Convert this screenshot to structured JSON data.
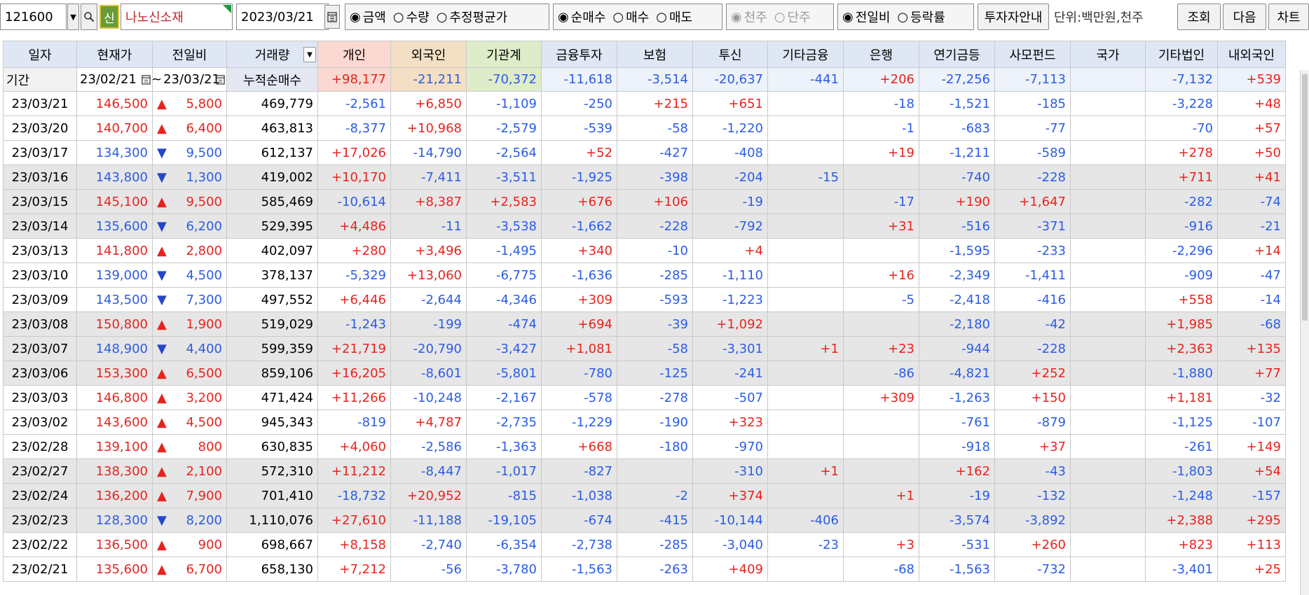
{
  "toolbar": {
    "code": "121600",
    "code_dropdown": "▼",
    "search_icon": "search-icon",
    "new_badge": "신",
    "name": "나노신소재",
    "date": "2023/03/21",
    "amount_options": [
      "금액",
      "수량",
      "추정평균가"
    ],
    "amount_selected": 0,
    "trade_options": [
      "순매수",
      "매수",
      "매도"
    ],
    "trade_selected": 0,
    "unit_options": [
      "천주",
      "단주"
    ],
    "unit_selected": 0,
    "compare_options": [
      "전일비",
      "등락률"
    ],
    "compare_selected": 0,
    "investor_guide": "투자자안내",
    "unit_text": "단위:백만원,천주",
    "query_btn": "조회",
    "next_btn": "다음",
    "chart_btn": "차트"
  },
  "period": {
    "label": "기간",
    "from": "23/02/21",
    "to": "23/03/21",
    "separator": "~",
    "cumulative_label": "누적순매수",
    "sums": [
      "+98,177",
      "-21,211",
      "-70,372",
      "-11,618",
      "-3,514",
      "-20,637",
      "-441",
      "+206",
      "-27,256",
      "-7,113",
      "",
      "-7,132",
      "+539"
    ]
  },
  "columns": [
    "일자",
    "현재가",
    "전일비",
    "거래량",
    "개인",
    "외국인",
    "기관계",
    "금융투자",
    "보험",
    "투신",
    "기타금융",
    "은행",
    "연기금등",
    "사모펀드",
    "국가",
    "기타법인",
    "내외국인"
  ],
  "accent_colors": {
    "up": "#e8231e",
    "down": "#2b5ce6",
    "individual_bg": "#fbd9d2",
    "foreign_bg": "#f3dfc3",
    "institution_bg": "#dfecc9",
    "header_bg": "#dfe7f5"
  },
  "rows": [
    {
      "date": "23/03/21",
      "price": "146,500",
      "dir": "up",
      "chg": "5,800",
      "vol": "469,779",
      "v": [
        "-2,561",
        "+6,850",
        "-1,109",
        "-250",
        "+215",
        "+651",
        "",
        "-18",
        "-1,521",
        "-185",
        "",
        "-3,228",
        "+48"
      ],
      "gray": false
    },
    {
      "date": "23/03/20",
      "price": "140,700",
      "dir": "up",
      "chg": "6,400",
      "vol": "463,813",
      "v": [
        "-8,377",
        "+10,968",
        "-2,579",
        "-539",
        "-58",
        "-1,220",
        "",
        "-1",
        "-683",
        "-77",
        "",
        "-70",
        "+57"
      ],
      "gray": false
    },
    {
      "date": "23/03/17",
      "price": "134,300",
      "dir": "down",
      "chg": "9,500",
      "vol": "612,137",
      "v": [
        "+17,026",
        "-14,790",
        "-2,564",
        "+52",
        "-427",
        "-408",
        "",
        "+19",
        "-1,211",
        "-589",
        "",
        "+278",
        "+50"
      ],
      "gray": false
    },
    {
      "date": "23/03/16",
      "price": "143,800",
      "dir": "down",
      "chg": "1,300",
      "vol": "419,002",
      "v": [
        "+10,170",
        "-7,411",
        "-3,511",
        "-1,925",
        "-398",
        "-204",
        "-15",
        "",
        "-740",
        "-228",
        "",
        "+711",
        "+41"
      ],
      "gray": true
    },
    {
      "date": "23/03/15",
      "price": "145,100",
      "dir": "up",
      "chg": "9,500",
      "vol": "585,469",
      "v": [
        "-10,614",
        "+8,387",
        "+2,583",
        "+676",
        "+106",
        "-19",
        "",
        "-17",
        "+190",
        "+1,647",
        "",
        "-282",
        "-74"
      ],
      "gray": true
    },
    {
      "date": "23/03/14",
      "price": "135,600",
      "dir": "down",
      "chg": "6,200",
      "vol": "529,395",
      "v": [
        "+4,486",
        "-11",
        "-3,538",
        "-1,662",
        "-228",
        "-792",
        "",
        "+31",
        "-516",
        "-371",
        "",
        "-916",
        "-21"
      ],
      "gray": true
    },
    {
      "date": "23/03/13",
      "price": "141,800",
      "dir": "up",
      "chg": "2,800",
      "vol": "402,097",
      "v": [
        "+280",
        "+3,496",
        "-1,495",
        "+340",
        "-10",
        "+4",
        "",
        "",
        "-1,595",
        "-233",
        "",
        "-2,296",
        "+14"
      ],
      "gray": false
    },
    {
      "date": "23/03/10",
      "price": "139,000",
      "dir": "down",
      "chg": "4,500",
      "vol": "378,137",
      "v": [
        "-5,329",
        "+13,060",
        "-6,775",
        "-1,636",
        "-285",
        "-1,110",
        "",
        "+16",
        "-2,349",
        "-1,411",
        "",
        "-909",
        "-47"
      ],
      "gray": false
    },
    {
      "date": "23/03/09",
      "price": "143,500",
      "dir": "down",
      "chg": "7,300",
      "vol": "497,552",
      "v": [
        "+6,446",
        "-2,644",
        "-4,346",
        "+309",
        "-593",
        "-1,223",
        "",
        "-5",
        "-2,418",
        "-416",
        "",
        "+558",
        "-14"
      ],
      "gray": false
    },
    {
      "date": "23/03/08",
      "price": "150,800",
      "dir": "up",
      "chg": "1,900",
      "vol": "519,029",
      "v": [
        "-1,243",
        "-199",
        "-474",
        "+694",
        "-39",
        "+1,092",
        "",
        "",
        "-2,180",
        "-42",
        "",
        "+1,985",
        "-68"
      ],
      "gray": true
    },
    {
      "date": "23/03/07",
      "price": "148,900",
      "dir": "down",
      "chg": "4,400",
      "vol": "599,359",
      "v": [
        "+21,719",
        "-20,790",
        "-3,427",
        "+1,081",
        "-58",
        "-3,301",
        "+1",
        "+23",
        "-944",
        "-228",
        "",
        "+2,363",
        "+135"
      ],
      "gray": true
    },
    {
      "date": "23/03/06",
      "price": "153,300",
      "dir": "up",
      "chg": "6,500",
      "vol": "859,106",
      "v": [
        "+16,205",
        "-8,601",
        "-5,801",
        "-780",
        "-125",
        "-241",
        "",
        "-86",
        "-4,821",
        "+252",
        "",
        "-1,880",
        "+77"
      ],
      "gray": true
    },
    {
      "date": "23/03/03",
      "price": "146,800",
      "dir": "up",
      "chg": "3,200",
      "vol": "471,424",
      "v": [
        "+11,266",
        "-10,248",
        "-2,167",
        "-578",
        "-278",
        "-507",
        "",
        "+309",
        "-1,263",
        "+150",
        "",
        "+1,181",
        "-32"
      ],
      "gray": false
    },
    {
      "date": "23/03/02",
      "price": "143,600",
      "dir": "up",
      "chg": "4,500",
      "vol": "945,343",
      "v": [
        "-819",
        "+4,787",
        "-2,735",
        "-1,229",
        "-190",
        "+323",
        "",
        "",
        "-761",
        "-879",
        "",
        "-1,125",
        "-107"
      ],
      "gray": false
    },
    {
      "date": "23/02/28",
      "price": "139,100",
      "dir": "up",
      "chg": "800",
      "vol": "630,835",
      "v": [
        "+4,060",
        "-2,586",
        "-1,363",
        "+668",
        "-180",
        "-970",
        "",
        "",
        "-918",
        "+37",
        "",
        "-261",
        "+149"
      ],
      "gray": false
    },
    {
      "date": "23/02/27",
      "price": "138,300",
      "dir": "up",
      "chg": "2,100",
      "vol": "572,310",
      "v": [
        "+11,212",
        "-8,447",
        "-1,017",
        "-827",
        "",
        "-310",
        "+1",
        "",
        "+162",
        "-43",
        "",
        "-1,803",
        "+54"
      ],
      "gray": true
    },
    {
      "date": "23/02/24",
      "price": "136,200",
      "dir": "up",
      "chg": "7,900",
      "vol": "701,410",
      "v": [
        "-18,732",
        "+20,952",
        "-815",
        "-1,038",
        "-2",
        "+374",
        "",
        "+1",
        "-19",
        "-132",
        "",
        "-1,248",
        "-157"
      ],
      "gray": true
    },
    {
      "date": "23/02/23",
      "price": "128,300",
      "dir": "down",
      "chg": "8,200",
      "vol": "1,110,076",
      "v": [
        "+27,610",
        "-11,188",
        "-19,105",
        "-674",
        "-415",
        "-10,144",
        "-406",
        "",
        "-3,574",
        "-3,892",
        "",
        "+2,388",
        "+295"
      ],
      "gray": true
    },
    {
      "date": "23/02/22",
      "price": "136,500",
      "dir": "up",
      "chg": "900",
      "vol": "698,667",
      "v": [
        "+8,158",
        "-2,740",
        "-6,354",
        "-2,738",
        "-285",
        "-3,040",
        "-23",
        "+3",
        "-531",
        "+260",
        "",
        "+823",
        "+113"
      ],
      "gray": false
    },
    {
      "date": "23/02/21",
      "price": "135,600",
      "dir": "up",
      "chg": "6,700",
      "vol": "658,130",
      "v": [
        "+7,212",
        "-56",
        "-3,780",
        "-1,563",
        "-263",
        "+409",
        "",
        "-68",
        "-1,563",
        "-732",
        "",
        "-3,401",
        "+25"
      ],
      "gray": false
    }
  ]
}
